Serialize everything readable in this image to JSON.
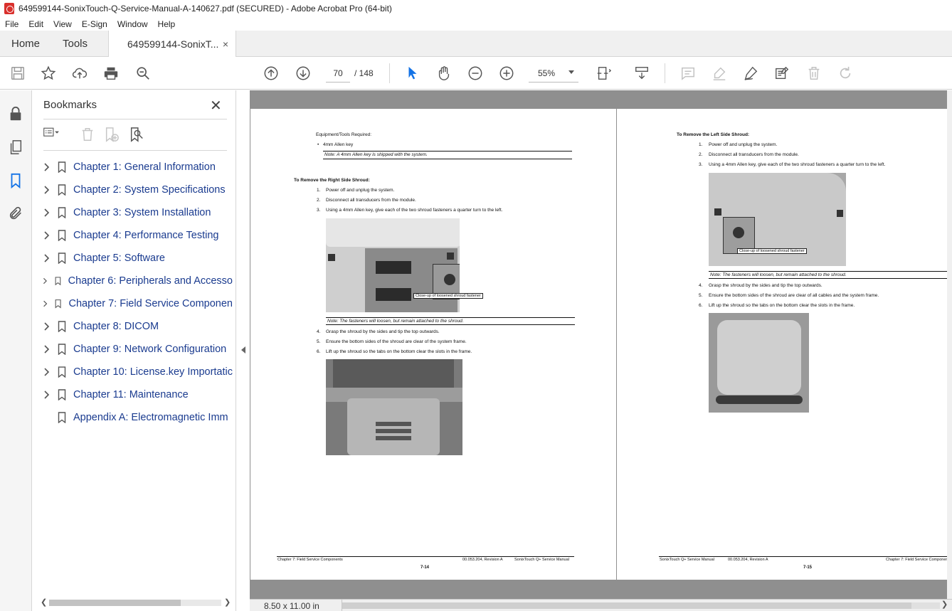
{
  "window": {
    "title": "649599144-SonixTouch-Q-Service-Manual-A-140627.pdf (SECURED) - Adobe Acrobat Pro (64-bit)"
  },
  "menu": [
    "File",
    "Edit",
    "View",
    "E-Sign",
    "Window",
    "Help"
  ],
  "tabs": {
    "home": "Home",
    "tools": "Tools",
    "doc": "649599144-SonixT...",
    "close": "×"
  },
  "toolbar": {
    "page_current": "70",
    "page_total": "/ 148",
    "zoom": "55%"
  },
  "bookmarks": {
    "title": "Bookmarks",
    "close": "✕",
    "items": [
      {
        "label": "Chapter 1: General Information",
        "expandable": true
      },
      {
        "label": "Chapter 2: System Specifications",
        "expandable": true
      },
      {
        "label": "Chapter 3: System Installation",
        "expandable": true
      },
      {
        "label": "Chapter 4: Performance Testing",
        "expandable": true
      },
      {
        "label": "Chapter 5: Software",
        "expandable": true
      },
      {
        "label": "Chapter 6: Peripherals and Accesso",
        "expandable": true
      },
      {
        "label": "Chapter 7: Field Service Componen",
        "expandable": true
      },
      {
        "label": "Chapter 8: DICOM",
        "expandable": true
      },
      {
        "label": "Chapter 9: Network Configuration",
        "expandable": true
      },
      {
        "label": "Chapter 10: License.key Importatic",
        "expandable": true
      },
      {
        "label": "Chapter 11: Maintenance",
        "expandable": true
      },
      {
        "label": "Appendix A: Electromagnetic Imm",
        "expandable": false
      }
    ]
  },
  "left_page": {
    "equip_heading": "Equipment/Tools Required:",
    "equip_item": "4mm Allen key",
    "note1": "Note: A 4mm Allen key is shipped with the system.",
    "heading": "To Remove the Right Side Shroud:",
    "steps_a": [
      {
        "n": "1.",
        "t": "Power off and unplug the system."
      },
      {
        "n": "2.",
        "t": "Disconnect all transducers from the module."
      },
      {
        "n": "3.",
        "t": "Using a 4mm Allen key, give each of the two shroud fasteners a quarter turn to the left."
      }
    ],
    "callout": "Close-up of loosened shroud fastener",
    "note2": "Note: The fasteners will loosen, but remain attached to the shroud.",
    "steps_b": [
      {
        "n": "4.",
        "t": "Grasp the shroud by the sides and tip the top outwards."
      },
      {
        "n": "5.",
        "t": "Ensure the bottom sides of the shroud are clear of the system frame."
      },
      {
        "n": "6.",
        "t": "Lift up the shroud so the tabs on the bottom clear the slots in the frame."
      }
    ],
    "footer_left": "Chapter 7: Field Service Components",
    "footer_mid": "00.053.204, Revision A",
    "footer_right": "SonixTouch Q+ Service Manual",
    "page_no": "7-14"
  },
  "right_page": {
    "heading": "To Remove the Left Side Shroud:",
    "steps_a": [
      {
        "n": "1.",
        "t": "Power off and unplug the system."
      },
      {
        "n": "2.",
        "t": "Disconnect all transducers from the module."
      },
      {
        "n": "3.",
        "t": "Using a 4mm Allen key, give each of the two shroud fasteners a quarter turn to the left."
      }
    ],
    "callout": "Close-up of loosened shroud fastener",
    "note": "Note: The fasteners will loosen, but remain attached to the shroud.",
    "steps_b": [
      {
        "n": "4.",
        "t": "Grasp the shroud by the sides and tip the top outwards."
      },
      {
        "n": "5.",
        "t": "Ensure the bottom sides of the shroud are clear of all cables and the system frame."
      },
      {
        "n": "6.",
        "t": "Lift up the shroud so the tabs on the bottom clear the slots in the frame."
      }
    ],
    "footer_left": "SonixTouch Q+ Service Manual",
    "footer_mid": "00.053.204, Revision A",
    "footer_right": "Chapter 7: Field Service Components",
    "page_no": "7-15"
  },
  "status": {
    "page_size": "8.50 x 11.00 in"
  },
  "colors": {
    "accent": "#1473e6",
    "bookmark_text": "#1a3b8f",
    "doc_bg": "#8f8f8f"
  }
}
